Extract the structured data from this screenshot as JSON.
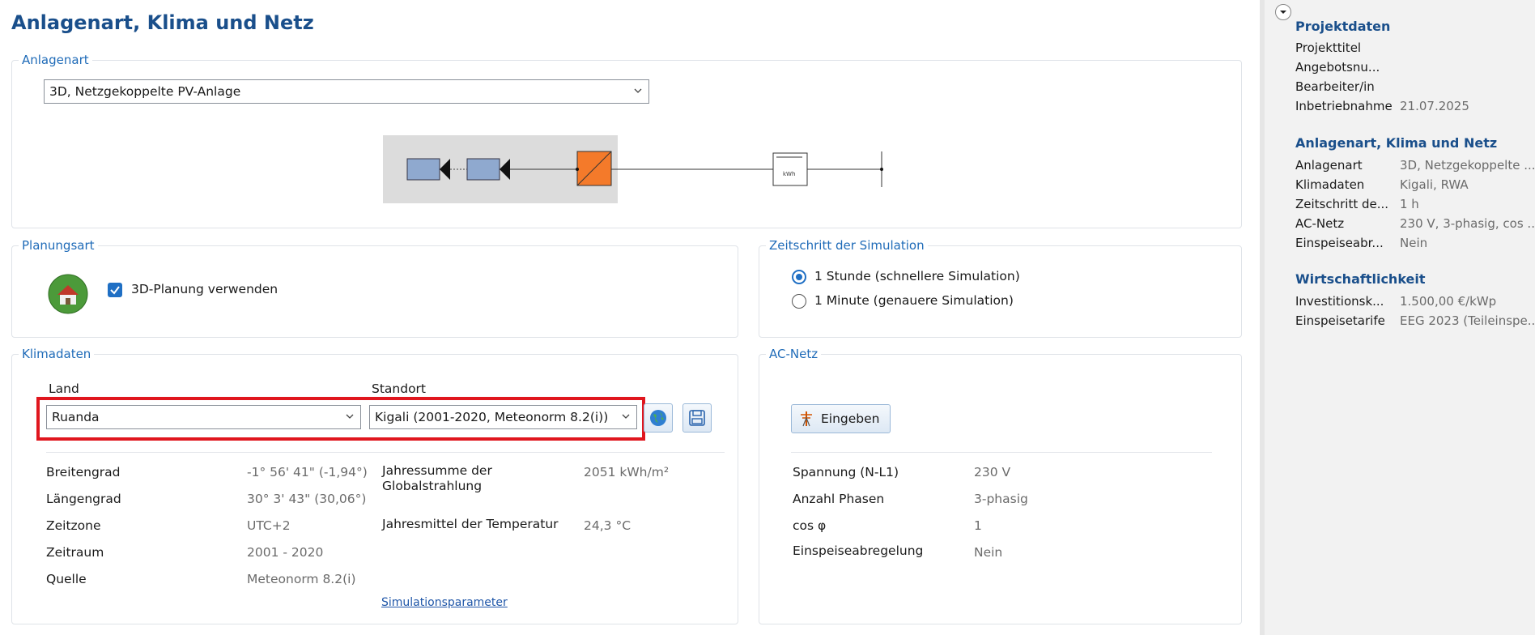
{
  "page": {
    "title": "Anlagenart, Klima und Netz"
  },
  "anlagenart": {
    "group_title": "Anlagenart",
    "selected": "3D, Netzgekoppelte PV-Anlage",
    "diagram_meter_label": "kWh"
  },
  "planungsart": {
    "group_title": "Planungsart",
    "checkbox_label": "3D-Planung verwenden",
    "checked": true
  },
  "zeitschritt": {
    "group_title": "Zeitschritt der Simulation",
    "options": [
      {
        "label": "1 Stunde (schnellere Simulation)",
        "selected": true
      },
      {
        "label": "1 Minute (genauere Simulation)",
        "selected": false
      }
    ]
  },
  "klimadaten": {
    "group_title": "Klimadaten",
    "land_label": "Land",
    "land_value": "Ruanda",
    "standort_label": "Standort",
    "standort_value": "Kigali (2001-2020, Meteonorm 8.2(i))",
    "rows": [
      {
        "label": "Breitengrad",
        "value": "-1° 56' 41\"  (-1,94°)"
      },
      {
        "label": "Längengrad",
        "value": "30° 3' 43\"  (30,06°)"
      },
      {
        "label": "Zeitzone",
        "value": "UTC+2"
      },
      {
        "label": "Zeitraum",
        "value": "2001 - 2020"
      },
      {
        "label": "Quelle",
        "value": "Meteonorm 8.2(i)"
      }
    ],
    "rows_right": [
      {
        "label": "Jahressumme der Globalstrahlung",
        "value": "2051 kWh/m²"
      },
      {
        "label": "Jahresmittel der Temperatur",
        "value": "24,3 °C"
      }
    ],
    "link": "Simulationsparameter"
  },
  "acnetz": {
    "group_title": "AC-Netz",
    "button_label": "Eingeben",
    "rows": [
      {
        "label": "Spannung (N-L1)",
        "value": "230 V"
      },
      {
        "label": "Anzahl Phasen",
        "value": "3-phasig"
      },
      {
        "label": "cos φ",
        "value": "1"
      },
      {
        "label": "Einspeiseabregelung",
        "value": "Nein"
      }
    ]
  },
  "sidebar": {
    "sections": [
      {
        "title": "Projektdaten",
        "rows": [
          {
            "k": "Projekttitel",
            "v": ""
          },
          {
            "k": "Angebotsnu...",
            "v": ""
          },
          {
            "k": "Bearbeiter/in",
            "v": ""
          },
          {
            "k": "Inbetriebnahme",
            "v": "21.07.2025"
          }
        ]
      },
      {
        "title": "Anlagenart, Klima und Netz",
        "rows": [
          {
            "k": "Anlagenart",
            "v": "3D, Netzgekoppelte ..."
          },
          {
            "k": "Klimadaten",
            "v": "Kigali, RWA"
          },
          {
            "k": "Zeitschritt de...",
            "v": "1 h"
          },
          {
            "k": "AC-Netz",
            "v": "230 V, 3-phasig, cos ..."
          },
          {
            "k": "Einspeiseabr...",
            "v": "Nein"
          }
        ]
      },
      {
        "title": "Wirtschaftlichkeit",
        "rows": [
          {
            "k": "Investitionsk...",
            "v": "1.500,00 €/kWp"
          },
          {
            "k": "Einspeisetarife",
            "v": "EEG 2023 (Teileinspe..."
          }
        ]
      }
    ]
  },
  "colors": {
    "accent": "#1f6fc4",
    "title": "#1a4f8b",
    "highlight": "#e0161e",
    "inverter": "#f47a2a",
    "module": "#8fa9cf"
  }
}
